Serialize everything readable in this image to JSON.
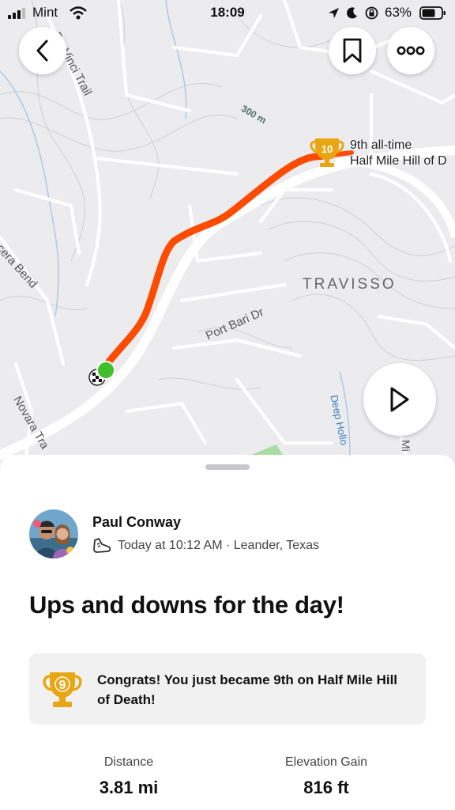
{
  "status_bar": {
    "carrier": "Mint",
    "time": "18:09",
    "battery": "63%"
  },
  "map": {
    "labels": {
      "davinci": "Da Vinci Trail",
      "scale": "300 m",
      "acera": "Acera Bend",
      "portbari": "Port Bari Dr",
      "travisso": "TRAVISSO",
      "novara": "Novara Tra",
      "deephollow": "Deep Hollo",
      "mi": "Mi"
    },
    "segment": {
      "rank_badge": "10",
      "line1": "9th all-time",
      "line2": "Half Mile Hill of D"
    },
    "route_color": "#fc4c02",
    "start_color": "#3fbf2a"
  },
  "buttons": {
    "back_icon": "chevron-left-icon",
    "bookmark_icon": "bookmark-icon",
    "more_icon": "more-icon",
    "play_icon": "play-icon"
  },
  "activity": {
    "athlete": "Paul Conway",
    "meta": "Today at 10:12 AM · Leander, Texas",
    "title": "Ups and downs for the day!",
    "achievement": {
      "rank": "9",
      "text": "Congrats! You just became 9th on Half Mile Hill of Death!"
    },
    "stats": [
      {
        "label": "Distance",
        "value": "3.81 mi"
      },
      {
        "label": "Elevation Gain",
        "value": "816 ft"
      }
    ]
  },
  "colors": {
    "accent": "#fc4c02",
    "trophy_gold": "#e8a612",
    "card_bg": "#f1f1f2"
  }
}
